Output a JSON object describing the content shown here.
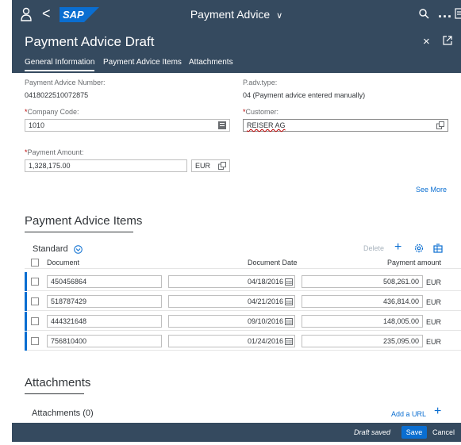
{
  "shell": {
    "title": "Payment Advice",
    "title_chevron": "∨",
    "back_glyph": "<",
    "more_glyph": "...",
    "logo_text": "SAP"
  },
  "header": {
    "title": "Payment Advice Draft",
    "close_glyph": "×"
  },
  "tabs": [
    {
      "label": "General Information"
    },
    {
      "label": "Payment Advice Items"
    },
    {
      "label": "Attachments"
    }
  ],
  "general": {
    "payment_advice_number_label": "Payment Advice Number:",
    "payment_advice_number_value": "0418022510072875",
    "padv_type_label": "P.adv.type:",
    "padv_type_value": "04 (Payment advice entered manually)",
    "company_code_label": "Company Code:",
    "company_code_value": "1010",
    "customer_label": "Customer:",
    "customer_value": "REISER AG",
    "payment_amount_label": "Payment Amount:",
    "payment_amount_value": "1,328,175.00",
    "currency_value": "EUR",
    "required_marker": "*",
    "see_more": "See More"
  },
  "items_section": {
    "title": "Payment Advice Items",
    "table_title": "Standard",
    "delete_label": "Delete",
    "add_glyph": "+",
    "columns": {
      "document": "Document",
      "document_date": "Document Date",
      "payment_amount": "Payment amount"
    },
    "rows": [
      {
        "document": "450456864",
        "date": "04/18/2016",
        "amount": "508,261.00",
        "currency": "EUR"
      },
      {
        "document": "518787429",
        "date": "04/21/2016",
        "amount": "436,814.00",
        "currency": "EUR"
      },
      {
        "document": "444321648",
        "date": "09/10/2016",
        "amount": "148,005.00",
        "currency": "EUR"
      },
      {
        "document": "756810400",
        "date": "01/24/2016",
        "amount": "235,095.00",
        "currency": "EUR"
      }
    ]
  },
  "attachments_section": {
    "title": "Attachments",
    "count_label": "Attachments (0)",
    "add_url": "Add a URL",
    "add_glyph": "+"
  },
  "footer": {
    "draft_saved": "Draft saved",
    "save": "Save",
    "cancel": "Cancel"
  },
  "colors": {
    "shell": "#354a5f",
    "accent": "#0a6ed1",
    "required": "#bb0000"
  }
}
